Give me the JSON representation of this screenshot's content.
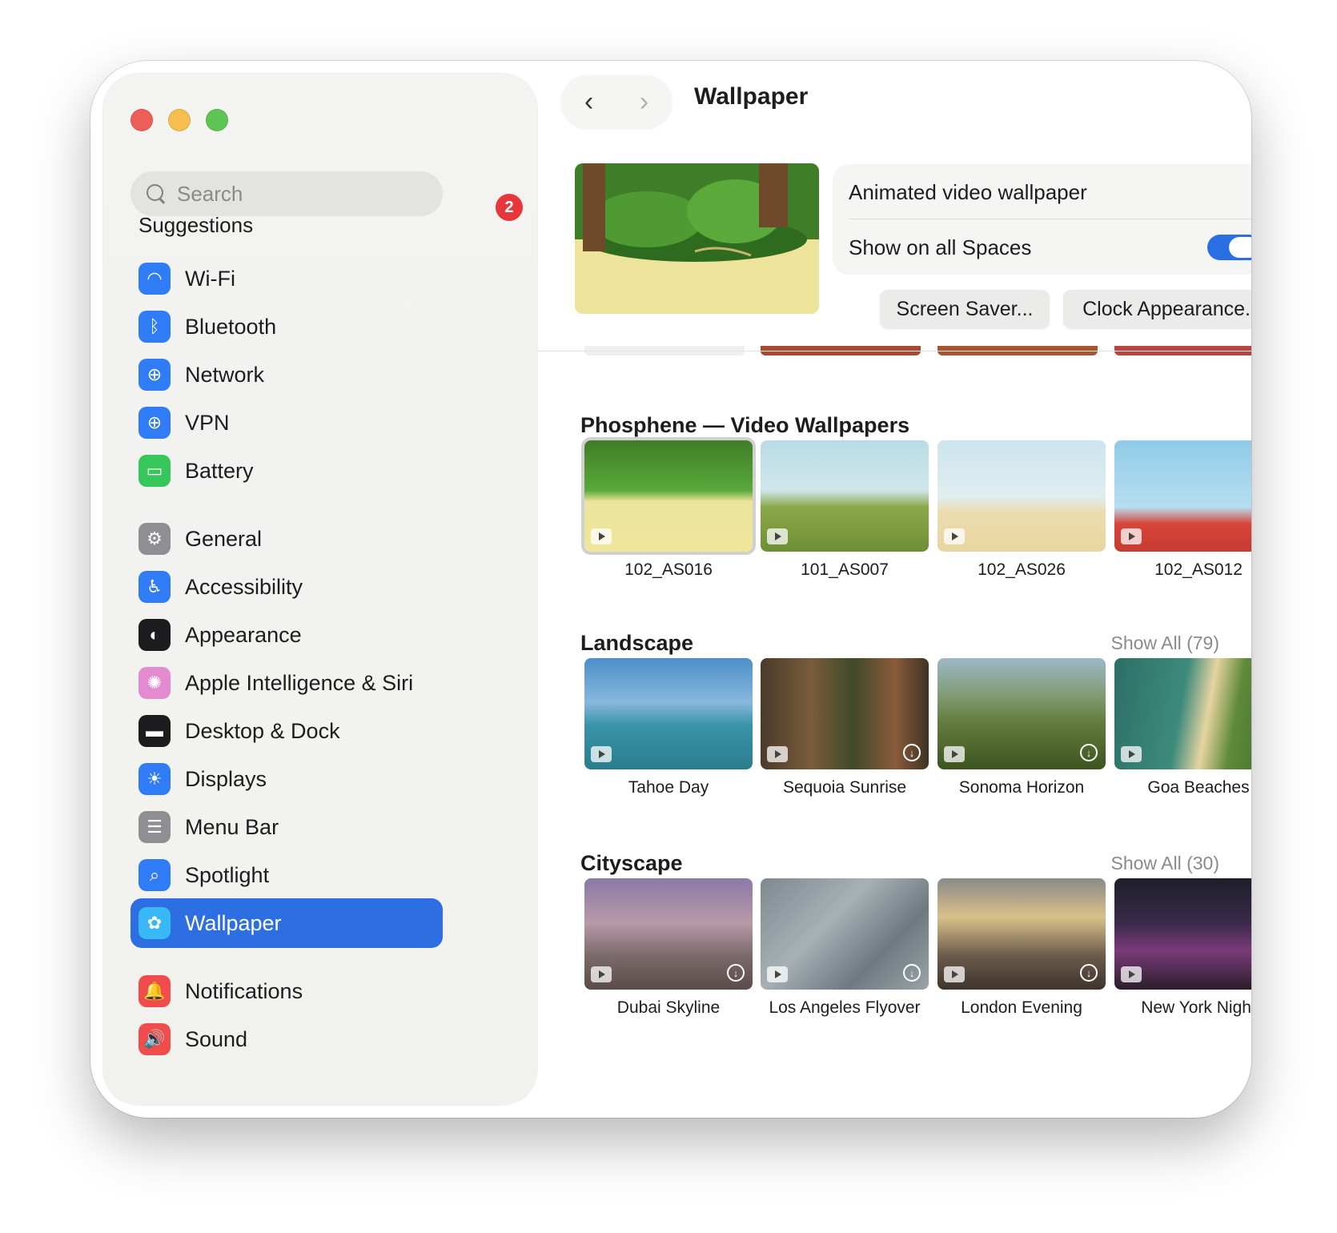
{
  "sidebar": {
    "search_placeholder": "Search",
    "badge_count": "2",
    "suggestions_label": "Suggestions",
    "items": [
      {
        "label": "Wi-Fi",
        "icon": "wifi-icon",
        "color": "#2f7cf6",
        "glyph": "◠"
      },
      {
        "label": "Bluetooth",
        "icon": "bluetooth-icon",
        "color": "#2f7cf6",
        "glyph": "ᛒ"
      },
      {
        "label": "Network",
        "icon": "globe-icon",
        "color": "#2f7cf6",
        "glyph": "⊕"
      },
      {
        "label": "VPN",
        "icon": "vpn-globe-icon",
        "color": "#2f7cf6",
        "glyph": "⊕"
      },
      {
        "label": "Battery",
        "icon": "battery-icon",
        "color": "#35c759",
        "glyph": "▭"
      },
      {
        "label": "General",
        "icon": "gear-icon",
        "color": "#8e8e93",
        "glyph": "⚙"
      },
      {
        "label": "Accessibility",
        "icon": "accessibility-icon",
        "color": "#2f7cf6",
        "glyph": "♿"
      },
      {
        "label": "Appearance",
        "icon": "appearance-icon",
        "color": "#1c1c1e",
        "glyph": "◐"
      },
      {
        "label": "Apple Intelligence & Siri",
        "icon": "siri-icon",
        "color": "#e48ad0",
        "glyph": "✺"
      },
      {
        "label": "Desktop & Dock",
        "icon": "dock-icon",
        "color": "#1c1c1e",
        "glyph": "▬"
      },
      {
        "label": "Displays",
        "icon": "displays-icon",
        "color": "#2f7cf6",
        "glyph": "☀"
      },
      {
        "label": "Menu Bar",
        "icon": "menubar-icon",
        "color": "#8e8e93",
        "glyph": "☰"
      },
      {
        "label": "Spotlight",
        "icon": "spotlight-icon",
        "color": "#2f7cf6",
        "glyph": "⌕"
      },
      {
        "label": "Wallpaper",
        "icon": "wallpaper-icon",
        "color": "#38b8f5",
        "glyph": "✿"
      },
      {
        "label": "Notifications",
        "icon": "notifications-icon",
        "color": "#f04c4c",
        "glyph": "🔔"
      },
      {
        "label": "Sound",
        "icon": "sound-icon",
        "color": "#f04c4c",
        "glyph": "🔊"
      }
    ]
  },
  "header": {
    "back": "‹",
    "forward": "›",
    "title": "Wallpaper"
  },
  "current": {
    "option_label": "Animated video wallpaper",
    "spaces_label": "Show on all Spaces",
    "spaces_on": true,
    "screen_saver_button": "Screen Saver...",
    "clock_button": "Clock Appearance..."
  },
  "sections": [
    {
      "title": "Phosphene — Video Wallpapers",
      "show_all": "",
      "items": [
        {
          "label": "102_AS016",
          "selected": true,
          "download": false
        },
        {
          "label": "101_AS007",
          "selected": false,
          "download": false
        },
        {
          "label": "102_AS026",
          "selected": false,
          "download": false
        },
        {
          "label": "102_AS012",
          "selected": false,
          "download": false
        }
      ]
    },
    {
      "title": "Landscape",
      "show_all": "Show All (79)",
      "items": [
        {
          "label": "Tahoe Day",
          "download": false
        },
        {
          "label": "Sequoia Sunrise",
          "download": true
        },
        {
          "label": "Sonoma Horizon",
          "download": true
        },
        {
          "label": "Goa Beaches",
          "download": true
        }
      ]
    },
    {
      "title": "Cityscape",
      "show_all": "Show All (30)",
      "items": [
        {
          "label": "Dubai Skyline",
          "download": true
        },
        {
          "label": "Los Angeles Flyover",
          "download": true
        },
        {
          "label": "London Evening",
          "download": true
        },
        {
          "label": "New York Night",
          "download": true
        }
      ]
    }
  ],
  "colors": {
    "accent": "#2d6ee3",
    "close": "#ec5f57",
    "minimize": "#f5be4f",
    "maximize": "#5ec454"
  }
}
